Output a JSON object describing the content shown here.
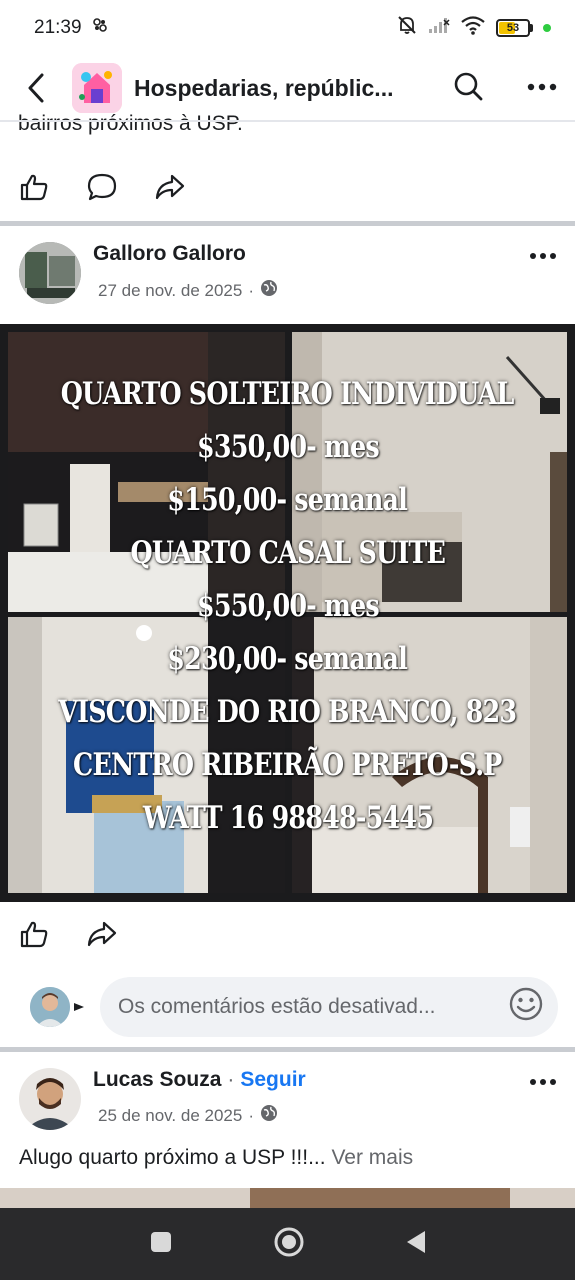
{
  "status_bar": {
    "time": "21:39",
    "battery": "53"
  },
  "header": {
    "title": "Hospedarias, repúblic..."
  },
  "prev_post": {
    "text_fragment": "bairros próximos à USP."
  },
  "post1": {
    "author": "Galloro Galloro",
    "date": "27 de nov. de 2025",
    "separator": "·",
    "image_lines": [
      "QUARTO SOLTEIRO INDIVIDUAL",
      "$350,00- mes",
      "$150,00- semanal",
      "QUARTO CASAL SUITE",
      "$550,00- mes",
      "$230,00- semanal",
      "VISCONDE DO RIO BRANCO, 823",
      "CENTRO RIBEIRÃO PRETO-S.P",
      "WATT 16 98848-5445"
    ]
  },
  "comment_box": {
    "placeholder": "Os comentários estão desativad..."
  },
  "post2": {
    "author": "Lucas Souza",
    "separator": "·",
    "follow": "Seguir",
    "date": "25 de nov. de 2025",
    "text": "Alugo quarto próximo a USP !!!...",
    "see_more": "Ver mais"
  },
  "colors": {
    "accent": "#1877f2",
    "muted": "#65676b",
    "text": "#1c1e21",
    "divider": "#c9ccd1"
  }
}
